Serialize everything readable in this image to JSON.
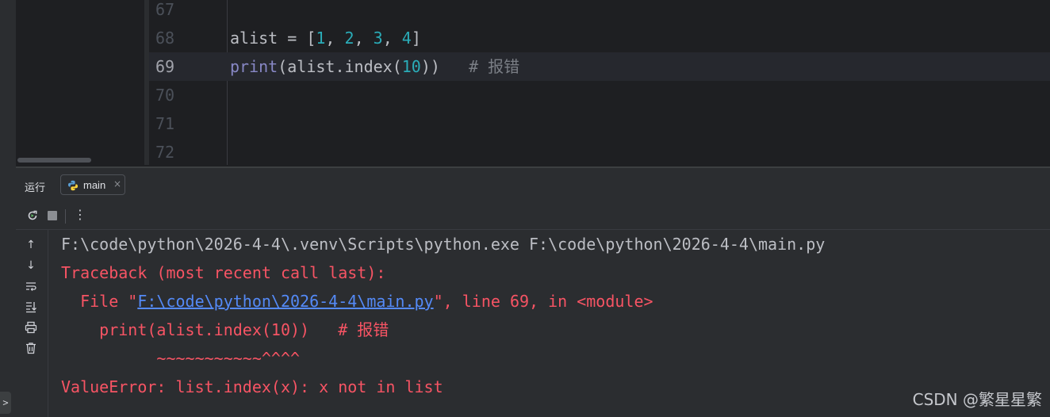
{
  "editor": {
    "lines": [
      {
        "num": "67",
        "parts": []
      },
      {
        "num": "68",
        "parts": [
          {
            "t": "alist = [",
            "c": "plain"
          },
          {
            "t": "1",
            "c": "num"
          },
          {
            "t": ", ",
            "c": "plain"
          },
          {
            "t": "2",
            "c": "num"
          },
          {
            "t": ", ",
            "c": "plain"
          },
          {
            "t": "3",
            "c": "num"
          },
          {
            "t": ", ",
            "c": "plain"
          },
          {
            "t": "4",
            "c": "num"
          },
          {
            "t": "]",
            "c": "plain"
          }
        ]
      },
      {
        "num": "69",
        "current": true,
        "parts": [
          {
            "t": "print",
            "c": "builtin"
          },
          {
            "t": "(alist.index(",
            "c": "plain"
          },
          {
            "t": "10",
            "c": "num"
          },
          {
            "t": "))   ",
            "c": "plain"
          },
          {
            "t": "# 报错",
            "c": "comment"
          }
        ]
      },
      {
        "num": "70",
        "parts": []
      },
      {
        "num": "71",
        "parts": []
      },
      {
        "num": "72",
        "parts": []
      }
    ]
  },
  "run_panel": {
    "title": "运行",
    "tab": {
      "label": "main",
      "close": "×"
    },
    "toolbar": {
      "rerun_icon": "rerun-icon",
      "stop_icon": "stop-icon",
      "more": "⋮"
    }
  },
  "console": {
    "cmd": "F:\\code\\python\\2026-4-4\\.venv\\Scripts\\python.exe F:\\code\\python\\2026-4-4\\main.py",
    "traceback": "Traceback (most recent call last):",
    "file_prefix": "  File \"",
    "file_path": "F:\\code\\python\\2026-4-4\\main.py",
    "file_suffix": "\", line 69, in <module>",
    "code_line": "    print(alist.index(10))   # 报错",
    "caret_line": "          ~~~~~~~~~~~^^^^",
    "error": "ValueError: list.index(x): x not in list"
  },
  "colors": {
    "background": "#1e1f22",
    "panel": "#2b2d30",
    "error_red": "#f75464",
    "link_blue": "#548af7",
    "number_teal": "#2aacb8"
  },
  "watermark": "CSDN @繁星星繁",
  "expand_label": ">"
}
